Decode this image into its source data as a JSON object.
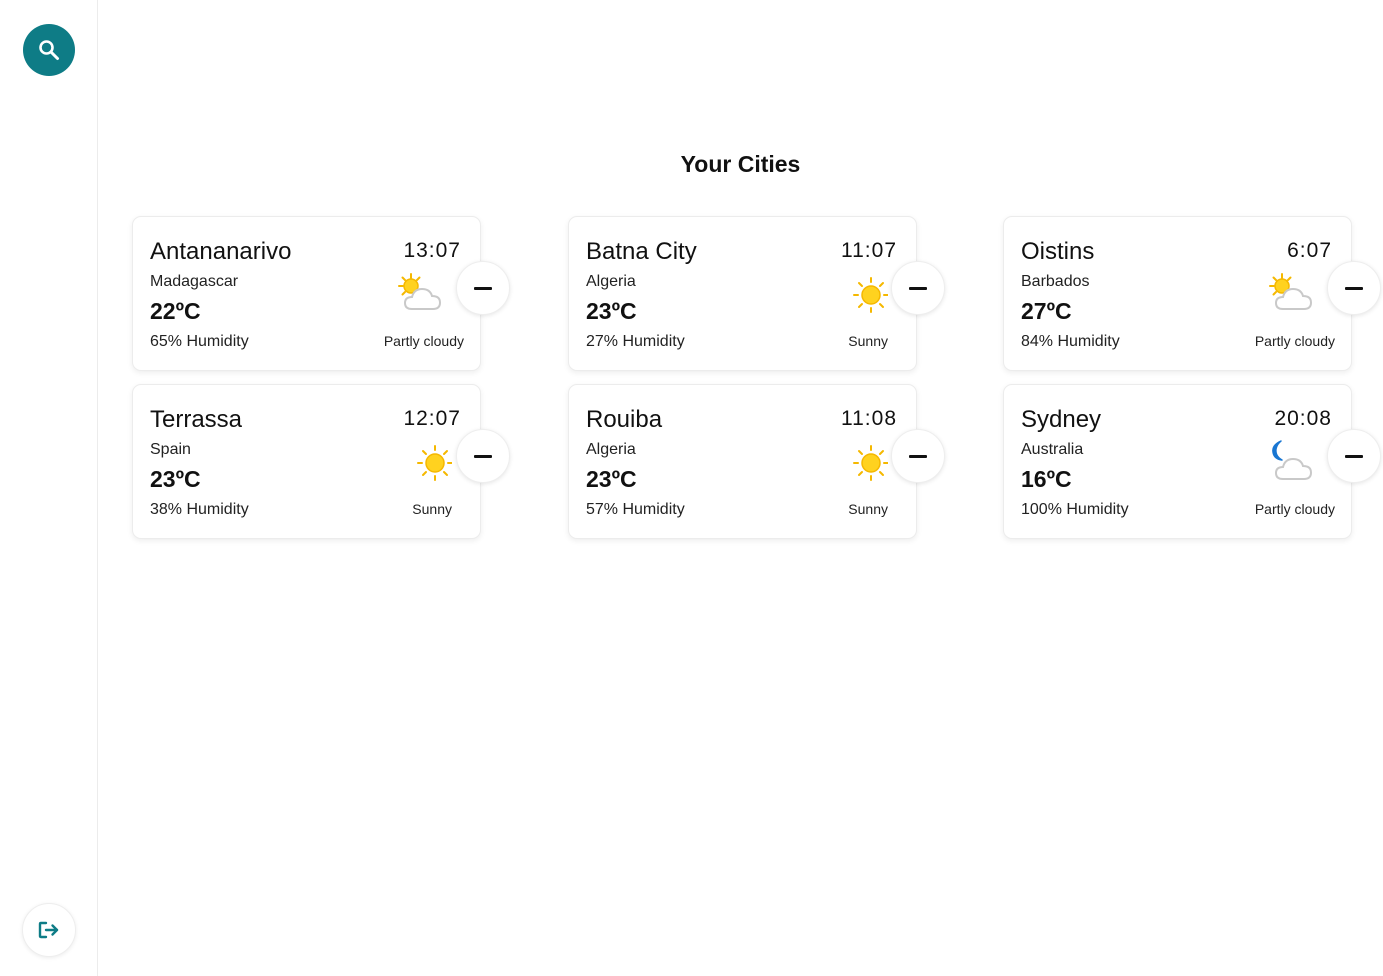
{
  "sidebar": {
    "search_icon": "search-icon",
    "logout_icon": "logout-icon",
    "accent_color": "#0e7c86"
  },
  "page": {
    "title": "Your Cities"
  },
  "cities": [
    {
      "name": "Antananarivo",
      "country": "Madagascar",
      "temp": "22ºC",
      "humidity": "65% Humidity",
      "time": "13:07",
      "condition": "Partly cloudy",
      "icon": "partly-cloudy-day-icon"
    },
    {
      "name": "Batna City",
      "country": "Algeria",
      "temp": "23ºC",
      "humidity": "27% Humidity",
      "time": "11:07",
      "condition": "Sunny",
      "icon": "sun-icon"
    },
    {
      "name": "Oistins",
      "country": "Barbados",
      "temp": "27ºC",
      "humidity": "84% Humidity",
      "time": "6:07",
      "condition": "Partly cloudy",
      "icon": "partly-cloudy-day-icon"
    },
    {
      "name": "Terrassa",
      "country": "Spain",
      "temp": "23ºC",
      "humidity": "38% Humidity",
      "time": "12:07",
      "condition": "Sunny",
      "icon": "sun-icon"
    },
    {
      "name": "Rouiba",
      "country": "Algeria",
      "temp": "23ºC",
      "humidity": "57% Humidity",
      "time": "11:08",
      "condition": "Sunny",
      "icon": "sun-icon"
    },
    {
      "name": "Sydney",
      "country": "Australia",
      "temp": "16ºC",
      "humidity": "100% Humidity",
      "time": "20:08",
      "condition": "Partly cloudy",
      "icon": "partly-cloudy-night-icon"
    }
  ]
}
